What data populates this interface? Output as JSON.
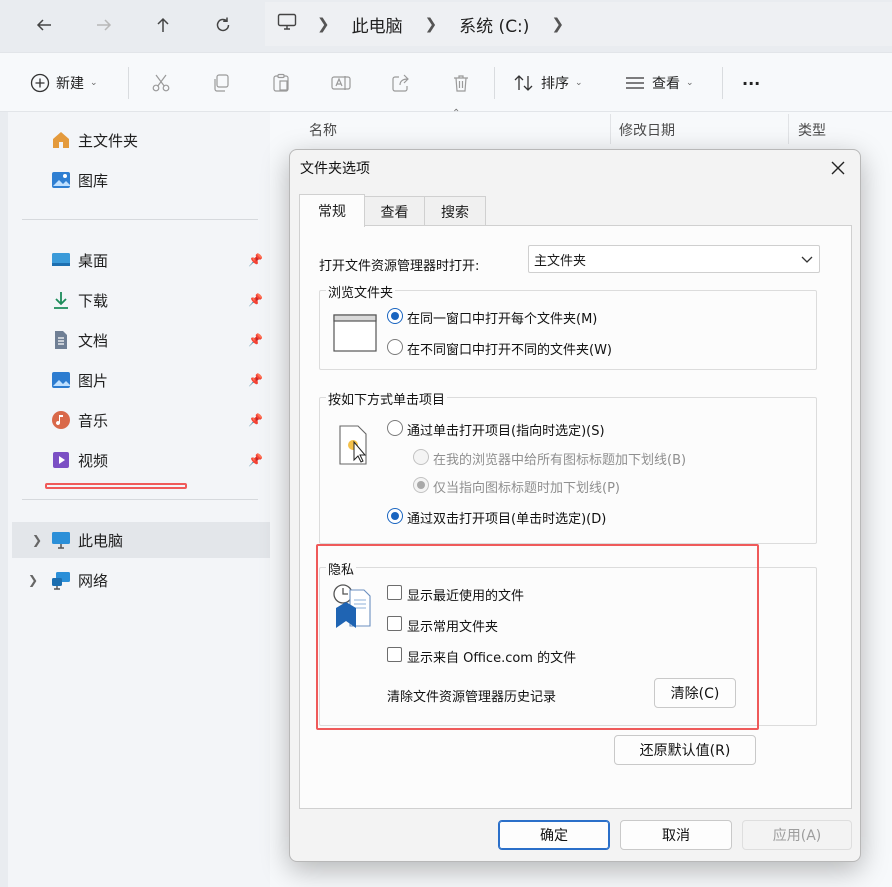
{
  "explorer": {
    "breadcrumb": [
      "此电脑",
      "系统 (C:)"
    ],
    "toolbar": {
      "new_label": "新建",
      "sort_label": "排序",
      "view_label": "查看",
      "more_label": "···"
    },
    "columns": [
      "名称",
      "修改日期",
      "类型"
    ],
    "sidebar": {
      "home": "主文件夹",
      "gallery": "图库",
      "pinned": [
        "桌面",
        "下载",
        "文档",
        "图片",
        "音乐",
        "视频"
      ],
      "this_pc": "此电脑",
      "network": "网络"
    }
  },
  "dialog": {
    "title": "文件夹选项",
    "tabs": [
      "常规",
      "查看",
      "搜索"
    ],
    "open_explorer_label": "打开文件资源管理器时打开:",
    "open_explorer_value": "主文件夹",
    "browse": {
      "legend": "浏览文件夹",
      "opt_same": "在同一窗口中打开每个文件夹(M)",
      "opt_new": "在不同窗口中打开不同的文件夹(W)"
    },
    "click": {
      "legend": "按如下方式单击项目",
      "opt_single": "通过单击打开项目(指向时选定)(S)",
      "sub_all": "在我的浏览器中给所有图标标题加下划线(B)",
      "sub_point": "仅当指向图标标题时加下划线(P)",
      "opt_double": "通过双击打开项目(单击时选定)(D)"
    },
    "privacy": {
      "legend": "隐私",
      "show_recent": "显示最近使用的文件",
      "show_frequent": "显示常用文件夹",
      "show_office": "显示来自 Office.com 的文件",
      "clear_label": "清除文件资源管理器历史记录",
      "clear_button": "清除(C)"
    },
    "restore_button": "还原默认值(R)",
    "ok_button": "确定",
    "cancel_button": "取消",
    "apply_button": "应用(A)"
  },
  "colors": {
    "accent": "#1a65c0",
    "annotation": "#ef5a5a"
  }
}
